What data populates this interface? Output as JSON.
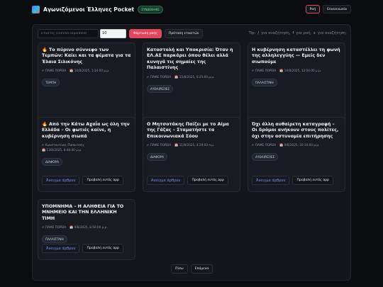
{
  "header": {
    "title": "Αγωνιζόμενοι Έλληνες Pocket",
    "sync_badge": "ΣΥΝΔΕΘΗΚΕ",
    "feed_label": "Ροή",
    "contact_label": "Επικοινωνία"
  },
  "toolbar": {
    "tags_placeholder": "Ετικέτες (comma-separated)",
    "limit_value": "10",
    "load_label": "Φόρτωση ροής",
    "tags_label": "Πρόταση ετικετών",
    "hint_tip": "Tip:",
    "hint_key1": "/",
    "hint_search": "για αναζήτηση,",
    "hint_key2": "f",
    "hint_feed": "για ροή,",
    "hint_key3": "s",
    "hint_search2": "για αναζήτηση."
  },
  "card_actions": {
    "open_article": "Άνοιγμα άρθρου",
    "view_in_app": "Προβολή εντός app"
  },
  "cards": [
    {
      "title": "🔥 Το πύρινο σύννεφο των Τεμπών: Καίει και τα ψέματα για τα Έλαια Σιλικόνης",
      "author": "✍ ΠΑΜΕ ΠΟΡΕΙΑ",
      "date": "📅 16/8/2025, 1:34:00 μ.μ.",
      "tag": "ΤΕΜΠΗ"
    },
    {
      "title": "Καταστολή και Υποκρισία: Όταν η ΕΛ.ΑΣ παρκάρει όπου θέλει αλλά κυνηγά τις σημαίες της Παλαιστίνης",
      "author": "✍ ΠΑΜΕ ΠΟΡΕΙΑ",
      "date": "📅 15/8/2025, 6:25:00 μ.μ.",
      "tag": "ΑΥΘΑΙΡΕΣΙΕΣ"
    },
    {
      "title": "Η κυβέρνηση καταστέλλει τη φωνή της αλληλεγγύης — Εμείς δεν σιωπούμε",
      "author": "✍ ΠΑΜΕ ΠΟΡΕΙΑ",
      "date": "📅 14/8/2025, 12:04:00 μ.μ.",
      "tag": "ΠΑΛΑΙΣΤΙΝΗ"
    },
    {
      "title": "🔥 Από την Κάτω Αχαΐα ως όλη την Ελλάδα – Οι φωτιές καίνε, η κυβέρνηση σιωπά",
      "author": "✍ Κωνσταντίνος Παπουτσής",
      "date": "📅 13/8/2025, 8:48:00 μ.μ.",
      "tag": "ΔΙΑΦΟΡΑ"
    },
    {
      "title": "Ο Μητσοτάκης Παίζει με το Αίμα της Γάζας – Σταματήστε τα Επικοινωνιακά Σόου",
      "author": "✍ ΠΑΜΕ ΠΟΡΕΙΑ",
      "date": "📅 11/8/2025, 4:29:00 π.μ.",
      "tag": "ΔΙΑΦΟΡΑ"
    },
    {
      "title": "Όχι άλλη αυθαίρετη καταγραφή – Οι δρόμοι ανήκουν στους πολίτες, όχι στην αστυνομία επιτήρησης",
      "author": "✍ ΠΑΜΕ ΠΟΡΕΙΑ",
      "date": "📅 9/8/2025, 10:10:00 μ.μ.",
      "tag": "ΑΥΘΑΙΡΕΣΙΕΣ"
    },
    {
      "title": "ΥΠΟΜΝΗΜΑ – Η ΑΛΗΘΕΙΑ ΓΙΑ ΤΟ ΜΝΗΜΕΙΟ ΚΑΙ ΤΗΝ ΕΛΛΗΝΙΚΗ ΤΙΜΗ",
      "author": "✍ ΠΑΜΕ ΠΟΡΕΙΑ",
      "date": "📅 9/8/2025, 8:50:00 μ.μ.",
      "tag": "ΠΑΛΑΙΣΤΙΝΗ"
    }
  ],
  "pager": {
    "prev_label": "Πίσω",
    "next_label": "Επόμενα"
  }
}
